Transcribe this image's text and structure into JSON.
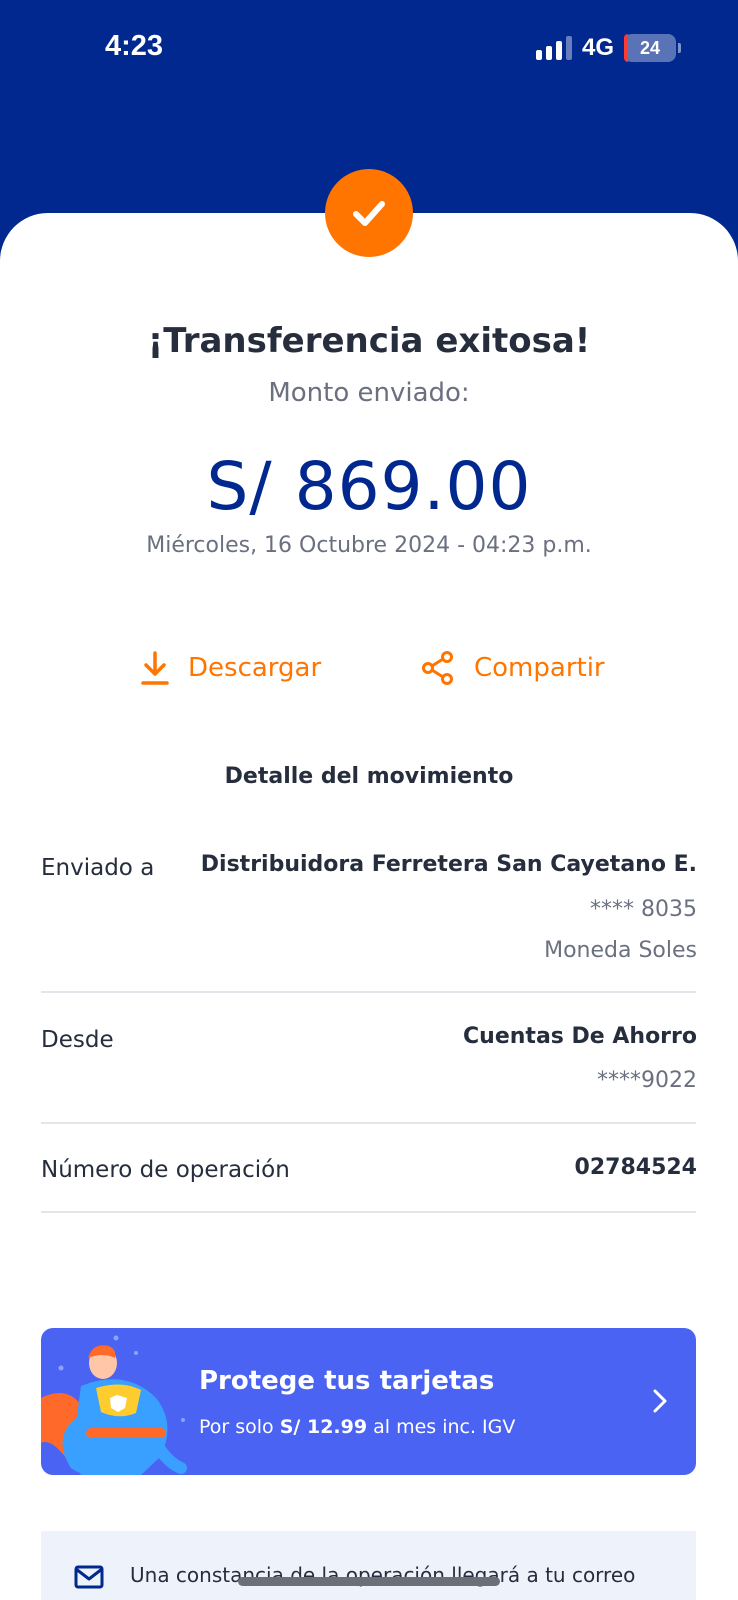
{
  "status_bar": {
    "time": "4:23",
    "network": "4G",
    "battery": "24"
  },
  "result": {
    "title": "¡Transferencia exitosa!",
    "subtitle": "Monto enviado:",
    "amount": "S/ 869.00",
    "datetime": "Miércoles, 16 Octubre 2024 - 04:23 p.m."
  },
  "actions": {
    "download_label": "Descargar",
    "share_label": "Compartir"
  },
  "detail": {
    "section_title": "Detalle del movimiento",
    "sent_to": {
      "label": "Enviado a",
      "name": "Distribuidora Ferretera San Cayetano E.",
      "account": "**** 8035",
      "currency": "Moneda Soles"
    },
    "from": {
      "label": "Desde",
      "account_type": "Cuentas De Ahorro",
      "account": "****9022"
    },
    "operation": {
      "label": "Número de operación",
      "number": "02784524"
    }
  },
  "promo": {
    "title": "Protege tus tarjetas",
    "sub_prefix": "Por solo ",
    "price": "S/ 12.99",
    "sub_suffix": " al mes inc. IGV"
  },
  "info": {
    "text": "Una constancia de la operación llegará a tu correo"
  },
  "colors": {
    "brand_blue": "#00288f",
    "accent_orange": "#ff7500",
    "promo_blue": "#4b63f2"
  }
}
